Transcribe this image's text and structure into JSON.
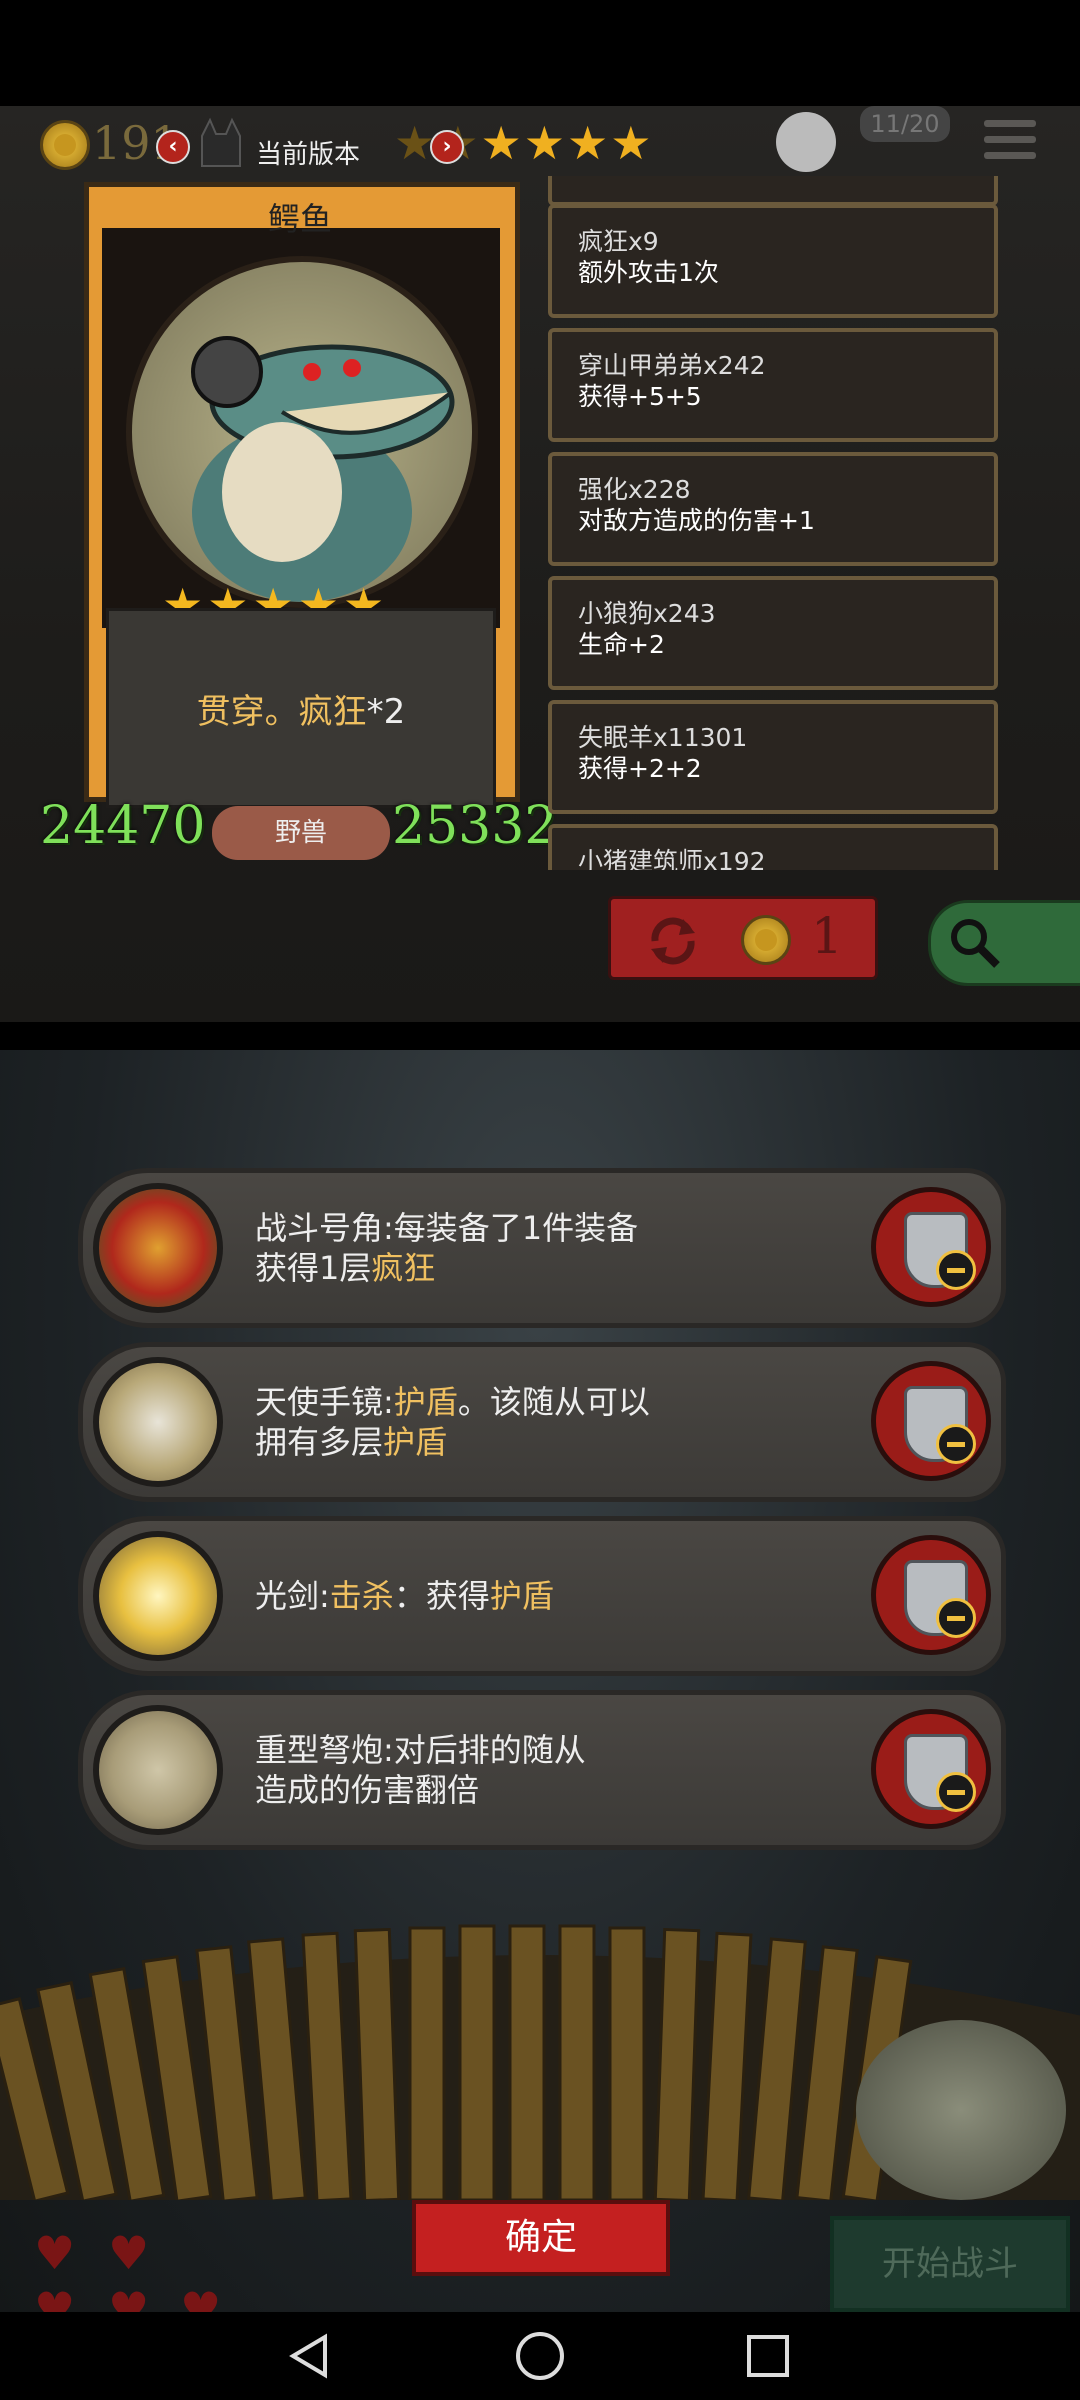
{
  "top": {
    "coins": "191",
    "version_label": "当前版本",
    "version_stars_total": 6,
    "version_stars_filled": 5,
    "player_badge": "11/20"
  },
  "card": {
    "name": "鳄鱼",
    "stars": 5,
    "desc_part1": "贯穿。疯狂",
    "desc_part2": "*2",
    "attack": "24470",
    "health": "25332",
    "type": "野兽"
  },
  "buffs": [
    {
      "line1": "疯狂x9",
      "line2": "额外攻击1次"
    },
    {
      "line1": "穿山甲弟弟x242",
      "line2": "获得+5+5"
    },
    {
      "line1": "强化x228",
      "line2": "对敌方造成的伤害+1"
    },
    {
      "line1": "小狼狗x243",
      "line2": "生命+2"
    },
    {
      "line1": "失眠羊x11301",
      "line2": "获得+2+2"
    },
    {
      "line1": "小猪建筑师x192",
      "line2": ""
    }
  ],
  "refresh": {
    "cost": "1"
  },
  "equipment": [
    {
      "name": "战斗号角:",
      "text_a": "每装备了1件装备",
      "text_b": "获得1层",
      "hl_b": "疯狂",
      "text_c": ""
    },
    {
      "name": "天使手镜:",
      "hl_a": "护盾",
      "text_a2": "。该随从可以",
      "text_b": "拥有多层",
      "hl_b": "护盾"
    },
    {
      "name": "光剑:",
      "hl_a": "击杀",
      "text_a2": "：获得",
      "hl_a3": "护盾"
    },
    {
      "name": "重型弩炮:",
      "text_a": "对后排的随从",
      "text_b": "造成的伤害翻倍"
    }
  ],
  "buttons": {
    "confirm": "确定",
    "start_battle": "开始战斗"
  },
  "colors": {
    "highlight": "#f0c060",
    "attack_health": "#7fe05a",
    "confirm_red": "#c42020"
  }
}
